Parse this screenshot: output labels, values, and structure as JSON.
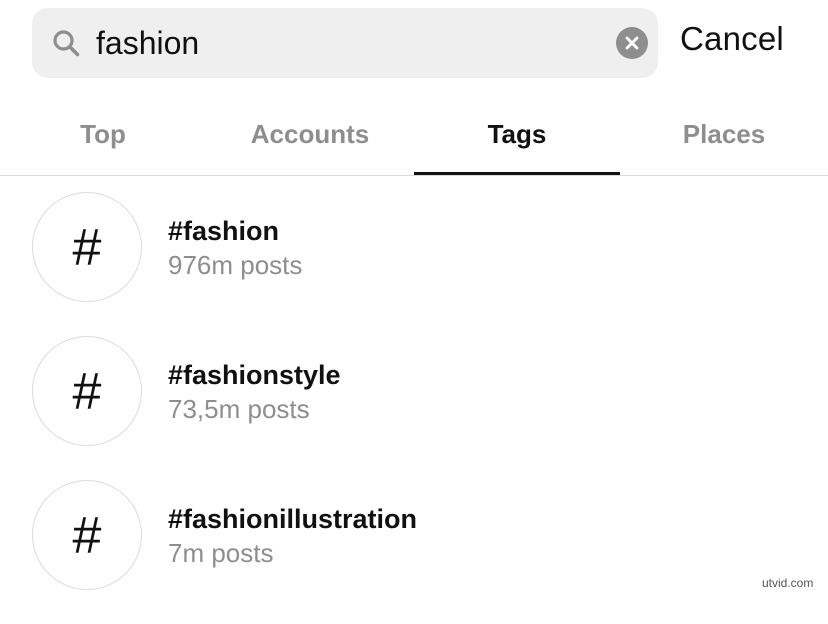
{
  "search": {
    "value": "fashion",
    "icon": "search-icon",
    "clear_icon": "clear-icon",
    "cancel_label": "Cancel"
  },
  "tabs": [
    {
      "label": "Top",
      "active": false
    },
    {
      "label": "Accounts",
      "active": false
    },
    {
      "label": "Tags",
      "active": true
    },
    {
      "label": "Places",
      "active": false
    }
  ],
  "results": [
    {
      "symbol": "#",
      "name": "#fashion",
      "count": "976m posts"
    },
    {
      "symbol": "#",
      "name": "#fashionstyle",
      "count": "73,5m posts"
    },
    {
      "symbol": "#",
      "name": "#fashionillustration",
      "count": "7m posts"
    }
  ],
  "watermark": "utvid.com",
  "colors": {
    "search_bg": "#efefef",
    "muted_text": "#8e8e8e",
    "primary_text": "#111111",
    "divider": "#dbdbdb"
  }
}
